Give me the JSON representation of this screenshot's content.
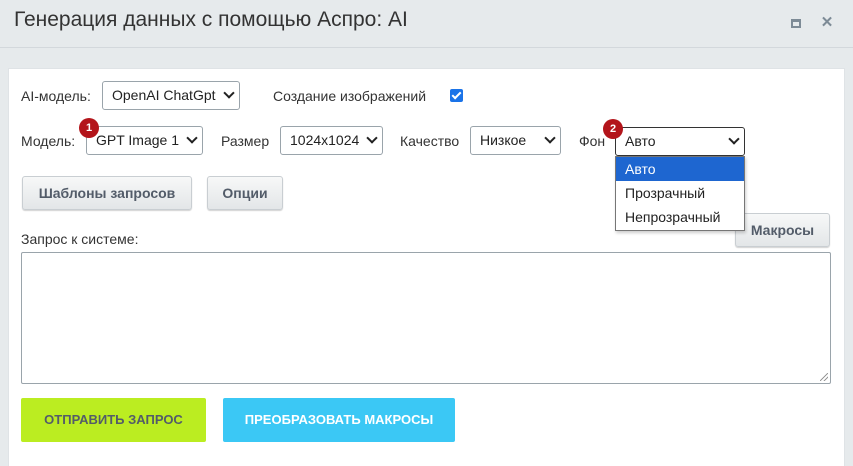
{
  "window": {
    "title": "Генерация данных с помощью Аспро: AI",
    "maximize_icon": "maximize-icon",
    "close_icon": "close-icon",
    "close_glyph": "✕"
  },
  "row1": {
    "ai_model_label": "AI-модель:",
    "ai_model_value": "OpenAI ChatGpt",
    "image_creation_label": "Создание изображений",
    "image_creation_checked": true
  },
  "row2": {
    "model_label": "Модель:",
    "model_value": "GPT Image 1",
    "size_label": "Размер",
    "size_value": "1024x1024",
    "quality_label": "Качество",
    "quality_value": "Низкое",
    "background_label": "Фон",
    "background_value": "Авто"
  },
  "badges": {
    "badge1": "1",
    "badge2": "2"
  },
  "background_dropdown": {
    "options": [
      "Авто",
      "Прозрачный",
      "Непрозрачный"
    ],
    "selected": "Авто"
  },
  "buttons": {
    "templates": "Шаблоны запросов",
    "options": "Опции",
    "macros": "Макросы",
    "send": "ОТПРАВИТЬ ЗАПРОС",
    "convert": "ПРЕОБРАЗОВАТЬ МАКРОСЫ"
  },
  "request": {
    "label": "Запрос к системе:",
    "value": ""
  },
  "colors": {
    "accent_green": "#bbed21",
    "accent_blue": "#3bc8f5",
    "badge_red": "#b3151b",
    "selection_blue": "#1e66d0"
  }
}
